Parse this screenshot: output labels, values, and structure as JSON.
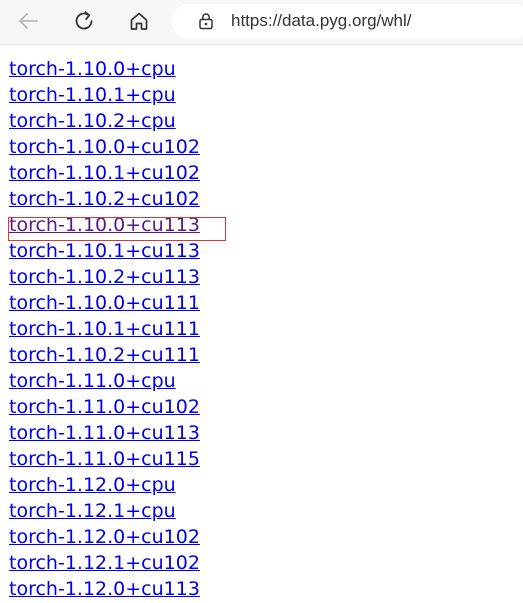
{
  "browser": {
    "url": "https://data.pyg.org/whl/",
    "icons": {
      "back": "back-arrow-icon",
      "refresh": "refresh-icon",
      "home": "home-icon",
      "lock": "lock-icon"
    }
  },
  "links": [
    "torch-1.10.0+cpu",
    "torch-1.10.1+cpu",
    "torch-1.10.2+cpu",
    "torch-1.10.0+cu102",
    "torch-1.10.1+cu102",
    "torch-1.10.2+cu102",
    "torch-1.10.0+cu113",
    "torch-1.10.1+cu113",
    "torch-1.10.2+cu113",
    "torch-1.10.0+cu111",
    "torch-1.10.1+cu111",
    "torch-1.10.2+cu111",
    "torch-1.11.0+cpu",
    "torch-1.11.0+cu102",
    "torch-1.11.0+cu113",
    "torch-1.11.0+cu115",
    "torch-1.12.0+cpu",
    "torch-1.12.1+cpu",
    "torch-1.12.0+cu102",
    "torch-1.12.1+cu102",
    "torch-1.12.0+cu113"
  ],
  "highlighted_link": "torch-1.10.0+cu113",
  "colors": {
    "link": "#0000ee",
    "visited_link": "#551a8b",
    "highlight_border": "#d9363e"
  }
}
